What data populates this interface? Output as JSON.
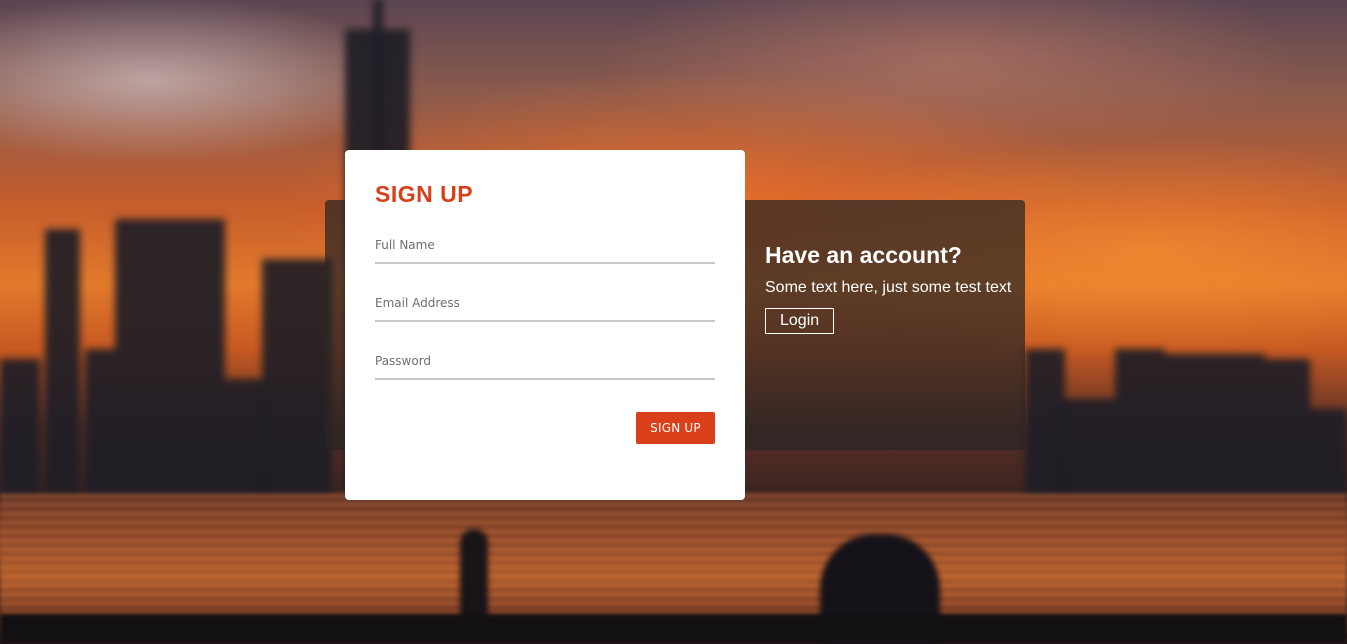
{
  "colors": {
    "accent": "#d9401a",
    "panel_overlay": "rgba(40,36,36,0.72)",
    "card_bg": "#ffffff",
    "input_border": "#c8c8c8"
  },
  "signup": {
    "title": "SIGN UP",
    "fields": [
      {
        "placeholder": "Full Name",
        "value": ""
      },
      {
        "placeholder": "Email Address",
        "value": ""
      },
      {
        "placeholder": "Password",
        "value": ""
      }
    ],
    "submit_label": "SIGN UP"
  },
  "login_panel": {
    "heading": "Have an account?",
    "text": "Some text here, just some test text",
    "button_label": "Login"
  },
  "background": {
    "scene": "blurred city skyline at sunset over water"
  }
}
